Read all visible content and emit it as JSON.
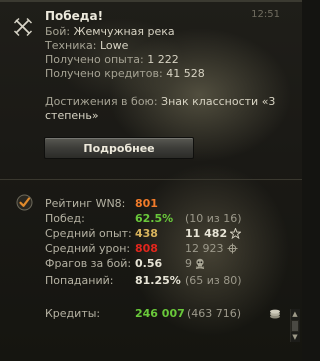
{
  "notification": {
    "time": "12:51",
    "title": "Победа!",
    "battle_label": "Бой:",
    "battle_value": "Жемчужная река",
    "vehicle_label": "Техника:",
    "vehicle_value": "Lowe",
    "xp_label": "Получено опыта:",
    "xp_value": "1 222",
    "credits_label": "Получено кредитов:",
    "credits_value": "41 528",
    "achievements_label": "Достижения в бою:",
    "achievements_value": "Знак классности «3 степень»",
    "details_button": "Подробнее"
  },
  "stats": {
    "rating": {
      "label": "Рейтинг WN8:",
      "value": "801"
    },
    "wins": {
      "label": "Побед:",
      "value": "62.5%",
      "extra": "(10 из 16)"
    },
    "avg_xp": {
      "label": "Средний опыт:",
      "value": "438",
      "extra": "11 482"
    },
    "avg_damage": {
      "label": "Средний урон:",
      "value": "808",
      "extra": "12 923"
    },
    "frags": {
      "label": "Фрагов за бой:",
      "value": "0.56",
      "extra": "9"
    },
    "hits": {
      "label": "Попаданий:",
      "value": "81.25%",
      "extra": "(65 из 80)"
    },
    "credits": {
      "label": "Кредиты:",
      "value": "246 007",
      "extra": "(463 716)"
    }
  },
  "icons": {
    "header": "crossed-swords-icon",
    "stats": "checkmark-icon",
    "xp": "star-icon",
    "damage": "crosshair-icon",
    "frags": "skull-icon",
    "credits": "coin-stack-icon"
  },
  "colors": {
    "wn8": "#f17b2a",
    "good": "#69c83a",
    "xp": "#d7b35c",
    "damage": "#e1261d"
  }
}
